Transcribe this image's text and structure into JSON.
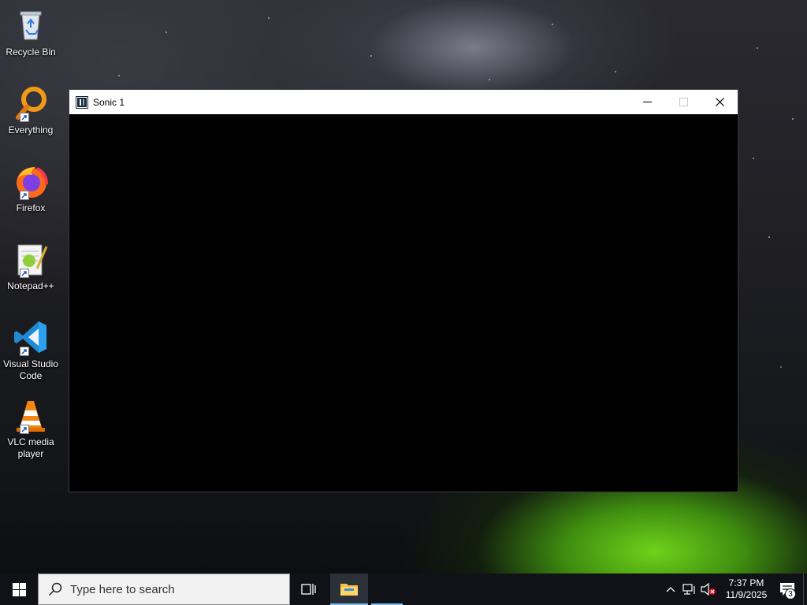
{
  "desktop": {
    "icons": [
      {
        "label": "Recycle Bin"
      },
      {
        "label": "Everything"
      },
      {
        "label": "Firefox"
      },
      {
        "label": "Notepad++"
      },
      {
        "label": "Visual Studio Code"
      },
      {
        "label": "VLC media player"
      }
    ]
  },
  "window": {
    "title": "Sonic 1"
  },
  "taskbar": {
    "search_placeholder": "Type here to search",
    "clock": {
      "time": "7:37 PM",
      "date": "11/9/2025"
    },
    "notification_count": "3"
  },
  "colors": {
    "taskbar_bg": "#101217",
    "active_indicator": "#76b9ed",
    "window_content": "#000000"
  }
}
